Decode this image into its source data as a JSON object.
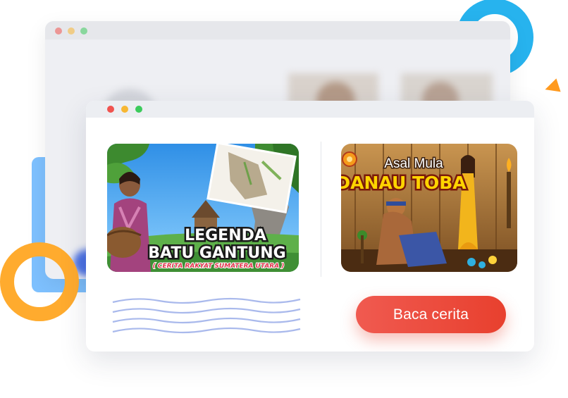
{
  "cards": [
    {
      "title_line1": "LEGENDA",
      "title_line2": "BATU GANTUNG",
      "subtitle": "( CERITA RAKYAT SUMATERA UTARA )"
    },
    {
      "title_line1": "Asal Mula",
      "title_line2": "DANAU TOBA"
    }
  ],
  "action": {
    "read_label": "Baca cerita"
  },
  "colors": {
    "accent_button": "#ea4a3a",
    "ring_cyan": "#27b3ee",
    "ring_orange": "#ffab2e",
    "block_blue": "#7ec1ff"
  }
}
